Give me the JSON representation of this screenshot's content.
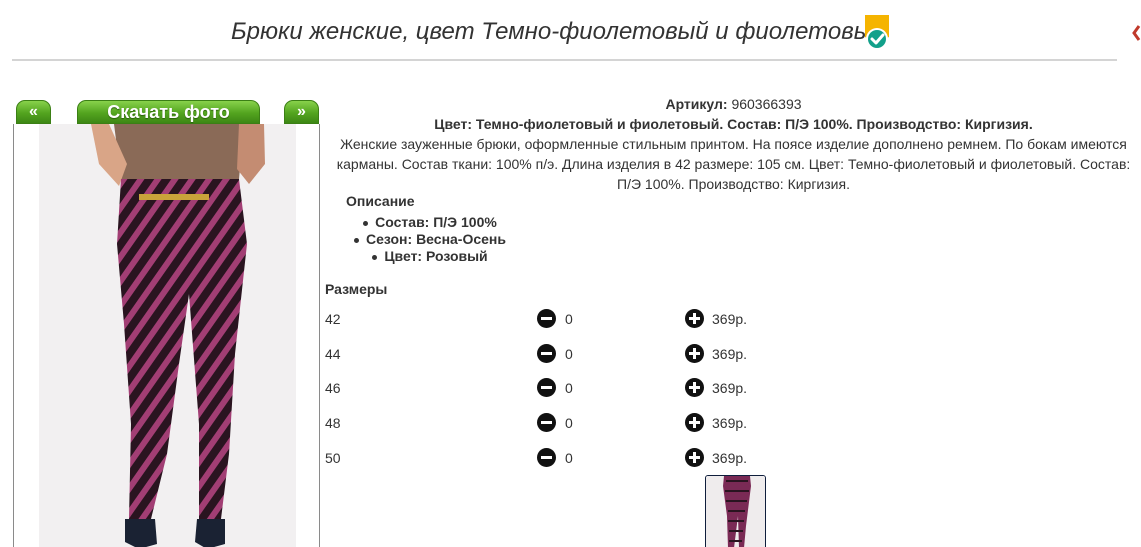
{
  "header": {
    "title": "Брюки женские, цвет Темно-фиолетовый и фиолетовый",
    "badge_icon": "verified-check-badge-icon",
    "accent_color": "#f5b400"
  },
  "gallery": {
    "prev_label": "«",
    "next_label": "»",
    "download_label": "Скачать фото",
    "button_color": "#53a41f"
  },
  "product": {
    "article_label": "Артикул:",
    "article_value": "960366393",
    "summary": "Цвет: Темно-фиолетовый и фиолетовый. Состав: П/Э 100%. Производство: Киргизия.",
    "description_line1": "Женские зауженные брюки, оформленные стильным принтом. На поясе изделие дополнено ремнем. По бокам имеются",
    "description_line2": "карманы. Состав ткани: 100% п/э. Длина изделия в 42 размере: 105 см. Цвет: Темно-фиолетовый и фиолетовый. Состав:",
    "description_line3": "П/Э 100%. Производство: Киргизия."
  },
  "description": {
    "heading": "Описание",
    "items": [
      "Состав: П/Э 100%",
      "Сезон: Весна-Осень",
      "Цвет: Розовый"
    ]
  },
  "sizes": {
    "heading": "Размеры",
    "rows": [
      {
        "size": "42",
        "qty": "0",
        "price": "369р."
      },
      {
        "size": "44",
        "qty": "0",
        "price": "369р."
      },
      {
        "size": "46",
        "qty": "0",
        "price": "369р."
      },
      {
        "size": "48",
        "qty": "0",
        "price": "369р."
      },
      {
        "size": "50",
        "qty": "0",
        "price": "369р."
      }
    ]
  }
}
